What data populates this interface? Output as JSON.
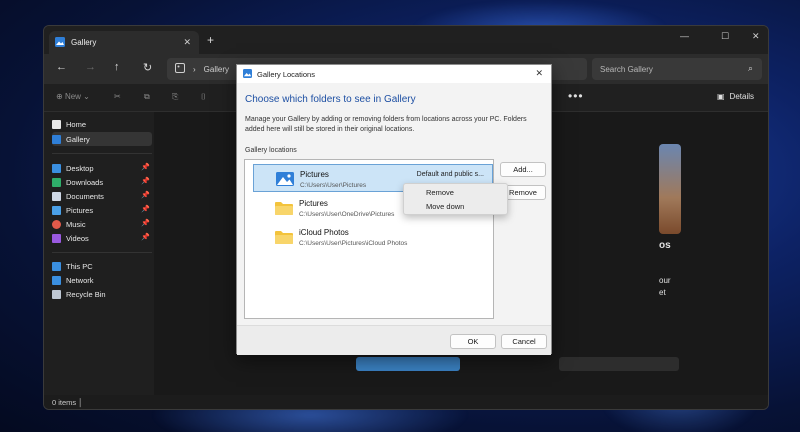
{
  "explorer": {
    "tab_title": "Gallery",
    "address_path": "Gallery",
    "search_placeholder": "Search Gallery",
    "new_label": "New",
    "details_label": "Details",
    "status": "0 items",
    "sidebar": {
      "home": "Home",
      "gallery": "Gallery",
      "desktop": "Desktop",
      "downloads": "Downloads",
      "documents": "Documents",
      "pictures": "Pictures",
      "music": "Music",
      "videos": "Videos",
      "this_pc": "This PC",
      "network": "Network",
      "recycle_bin": "Recycle Bin"
    },
    "promo": {
      "frag1": "os",
      "frag2": "our",
      "frag3": "et"
    }
  },
  "dialog": {
    "title": "Gallery Locations",
    "heading": "Choose which folders to see in Gallery",
    "description": "Manage your Gallery by adding or removing folders from locations across your PC. Folders added here will still be stored in their original locations.",
    "list_label": "Gallery locations",
    "locations": [
      {
        "name": "Pictures",
        "path": "C:\\Users\\User\\Pictures",
        "tag": "Default and public s..."
      },
      {
        "name": "Pictures",
        "path": "C:\\Users\\User\\OneDrive\\Pictures",
        "tag": ""
      },
      {
        "name": "iCloud Photos",
        "path": "C:\\Users\\User\\Pictures\\iCloud Photos",
        "tag": ""
      }
    ],
    "add_button": "Add...",
    "remove_button": "Remove",
    "ok_button": "OK",
    "cancel_button": "Cancel"
  },
  "context_menu": {
    "items": [
      "Remove",
      "Move down"
    ]
  }
}
